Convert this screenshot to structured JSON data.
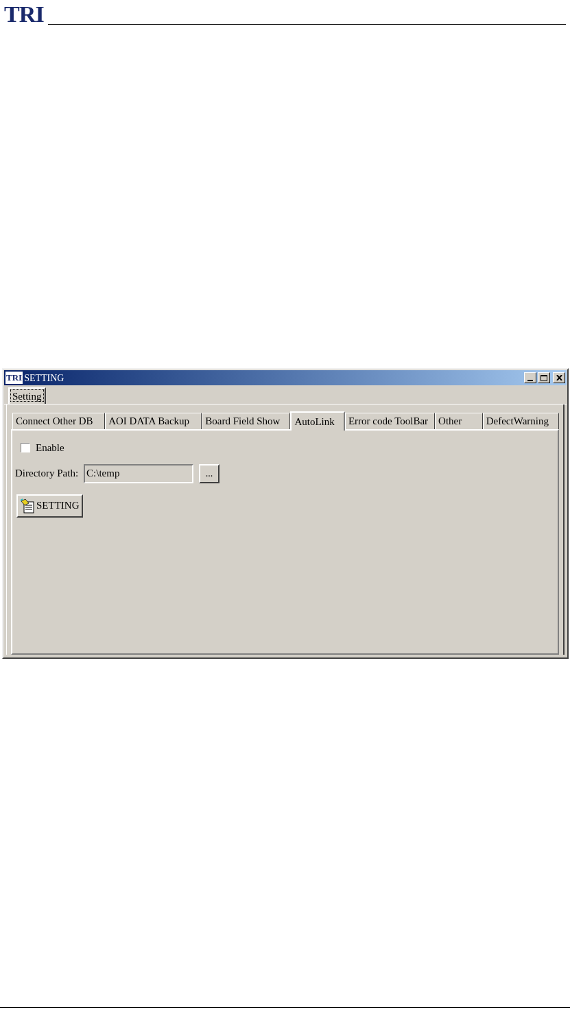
{
  "page_header": {
    "logo": "TRI"
  },
  "window": {
    "icon_text": "TRI",
    "title": "SETTING"
  },
  "outer_tabs": [
    {
      "label": "Setting",
      "selected": true
    }
  ],
  "tabs": [
    {
      "label": "Connect Other DB",
      "selected": false
    },
    {
      "label": "AOI DATA Backup",
      "selected": false
    },
    {
      "label": "Board Field Show",
      "selected": false
    },
    {
      "label": "AutoLink",
      "selected": true
    },
    {
      "label": "Error code ToolBar",
      "selected": false
    },
    {
      "label": "Other",
      "selected": false
    },
    {
      "label": "DefectWarning",
      "selected": false
    }
  ],
  "enable": {
    "label": "Enable",
    "checked": false
  },
  "directory": {
    "label": "Directory Path:",
    "value": "C:\\temp",
    "browse_button": "..."
  },
  "setting_button": "SETTING"
}
